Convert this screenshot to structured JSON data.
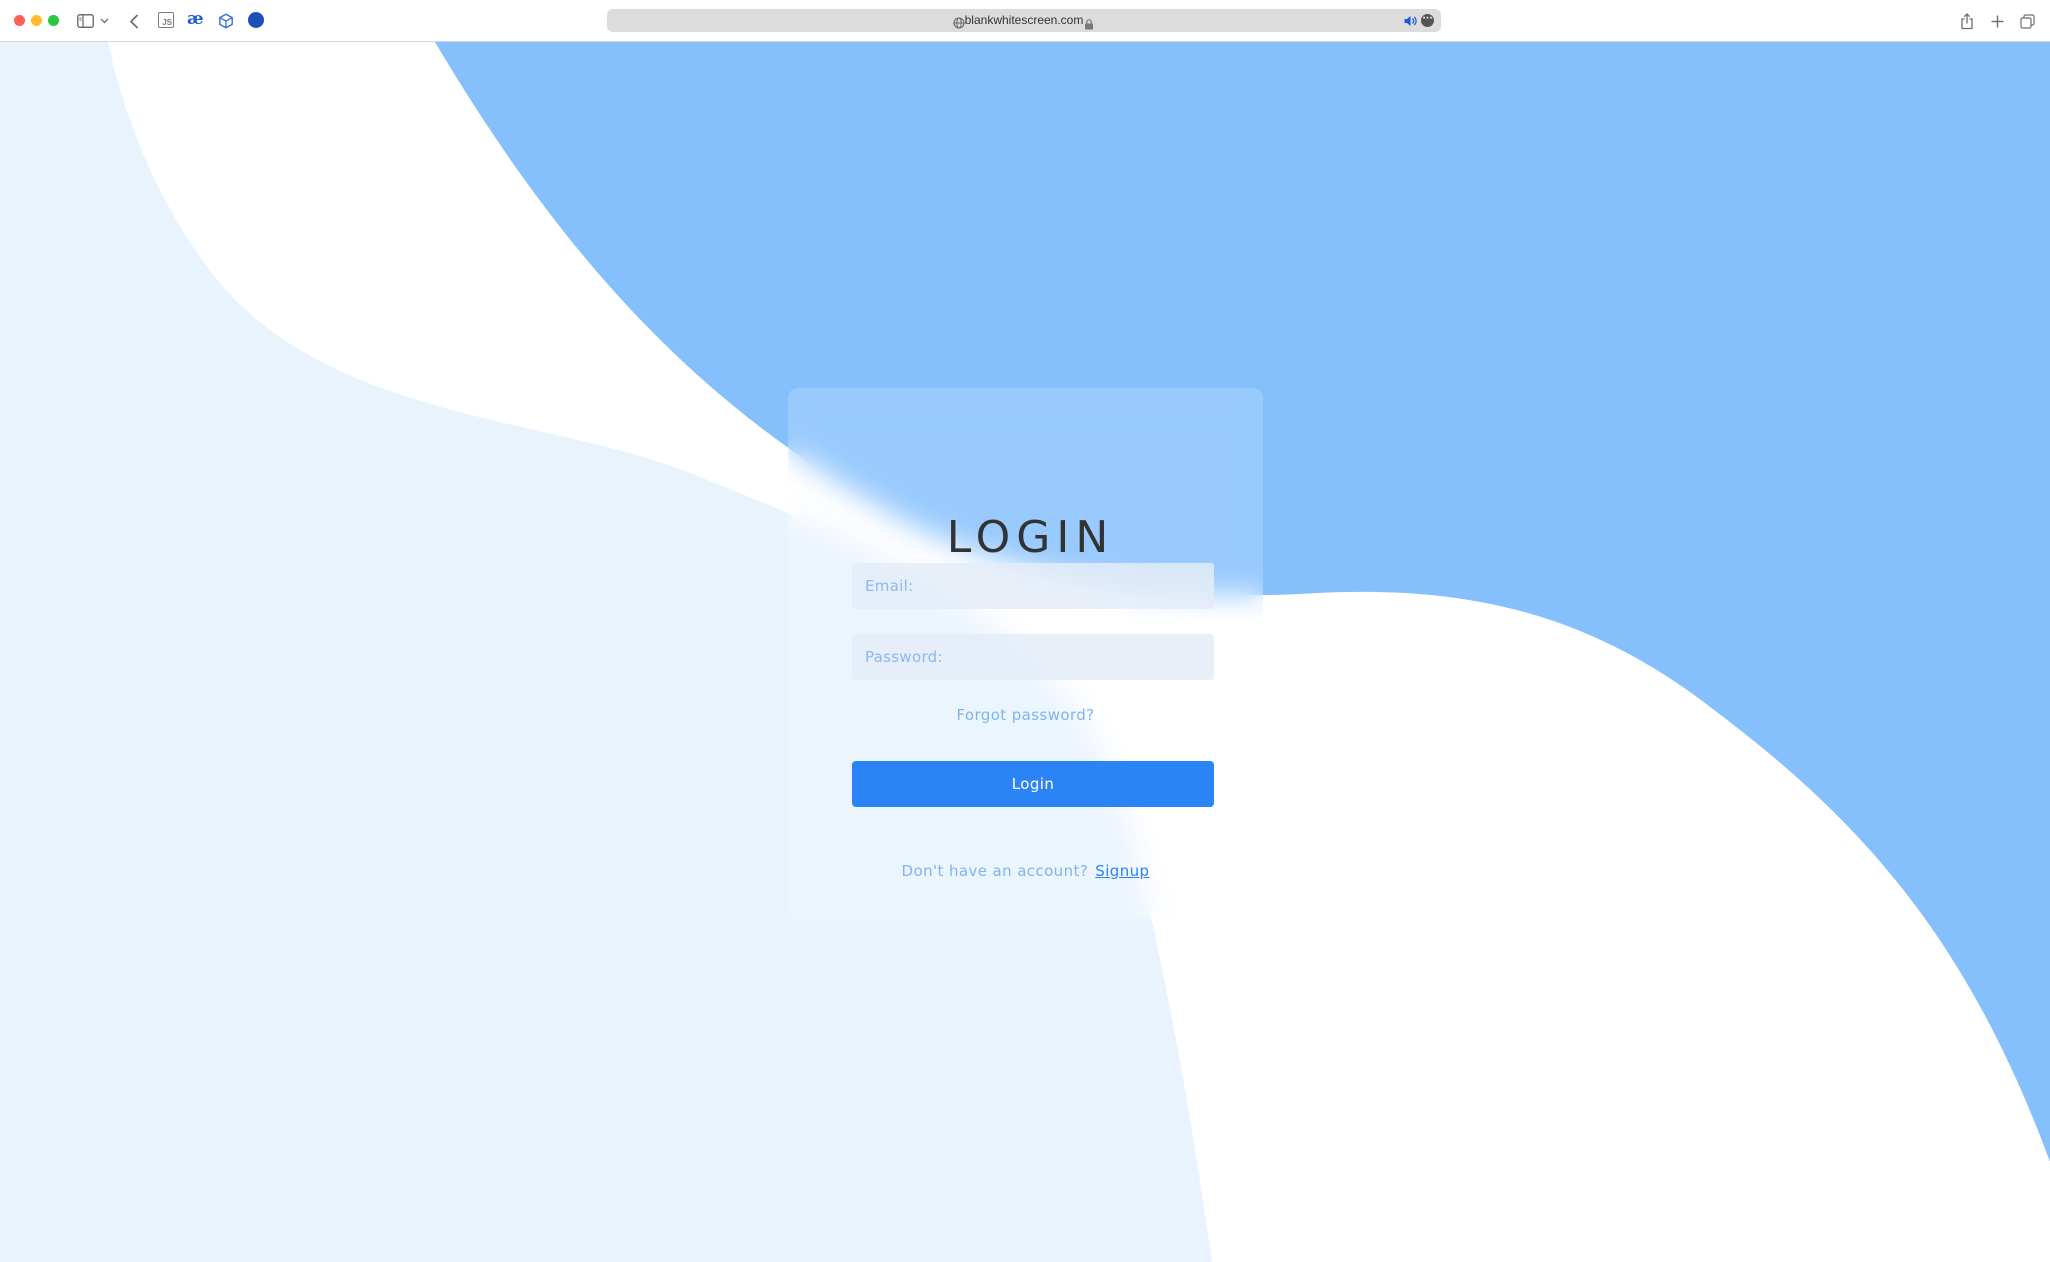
{
  "browser": {
    "url": "blankwhitescreen.com",
    "extensions": {
      "js_label": "JS",
      "ae_label": "æ"
    },
    "icons": [
      "sidebar-icon",
      "chevron-down-icon",
      "back-icon",
      "js-extension-icon",
      "ae-extension-icon",
      "cube-extension-icon",
      "globe-extension-icon",
      "site-icon",
      "lock-icon",
      "audio-icon",
      "more-icon",
      "share-icon",
      "new-tab-icon",
      "tab-overview-icon"
    ]
  },
  "colors": {
    "background_light": "#e8f3fe",
    "background_blue": "#85c0fd",
    "accent": "#2b84f5",
    "link_muted": "#7fb5ec"
  },
  "login": {
    "title": "LOGIN",
    "email_placeholder": "Email:",
    "password_placeholder": "Password:",
    "forgot_label": "Forgot password?",
    "button_label": "Login",
    "signup_prompt": "Don't have an account?",
    "signup_label": "Signup"
  }
}
